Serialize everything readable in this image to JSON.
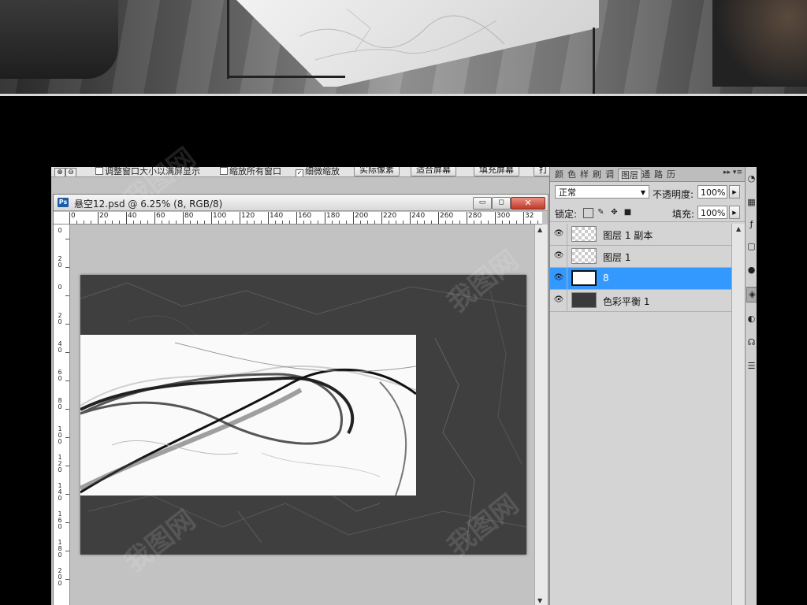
{
  "options_bar": {
    "fit_windows_label": "调整窗口大小以满屏显示",
    "zoom_all_label": "缩放所有窗口",
    "scrubby_zoom_label": "细微缩放",
    "scrubby_zoom_checkbox": "✓",
    "actual_pixels_label": "实际像素",
    "fit_screen_label": "适合屏幕",
    "fill_screen_label": "填充屏幕",
    "print_size_label": "打"
  },
  "document": {
    "app_icon_label": "Ps",
    "title": "悬空12.psd @ 6.25% (8, RGB/8)",
    "minimize_label": "▭",
    "maximize_label": "◻",
    "close_label": "✕",
    "ruler_h": [
      "0",
      "20",
      "40",
      "60",
      "80",
      "100",
      "120",
      "140",
      "160",
      "180",
      "200",
      "220",
      "240",
      "260",
      "280",
      "300",
      "32"
    ],
    "ruler_v": [
      "0",
      "20",
      "0",
      "20",
      "40",
      "60",
      "80",
      "100",
      "120",
      "140",
      "160",
      "180",
      "200"
    ]
  },
  "layers_panel": {
    "tabs": [
      "颜",
      "色",
      "样",
      "刷",
      "调",
      "图层",
      "通",
      "路",
      "历"
    ],
    "active_tab": "图层",
    "menu_glyph": "▸▸ ▾≡",
    "blend_mode": "正常",
    "opacity_label": "不透明度:",
    "opacity_value": "100%",
    "lock_label": "锁定:",
    "fill_label": "填充:",
    "fill_value": "100%",
    "layers": [
      {
        "name": "图层 1 副本",
        "thumb": "checker",
        "selected": false
      },
      {
        "name": "图层 1",
        "thumb": "checker",
        "selected": false
      },
      {
        "name": "8",
        "thumb": "white",
        "selected": true
      },
      {
        "name": "色彩平衡 1",
        "thumb": "dark",
        "selected": false
      }
    ]
  },
  "watermark": "我图网",
  "colors": {
    "selection": "#3399ff",
    "canvas_bg": "#c2c2c2",
    "artboard": "#3f3f3f",
    "close_button": "#c0392b"
  }
}
